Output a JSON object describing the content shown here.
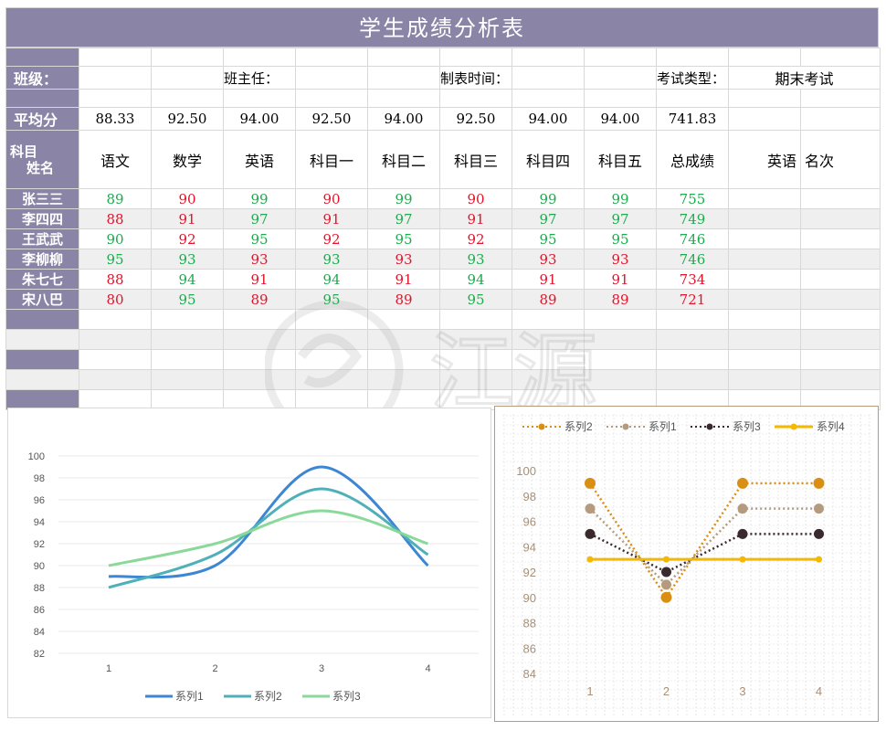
{
  "title": "学生成绩分析表",
  "info": {
    "class_label": "班级：",
    "teacher_label": "班主任：",
    "date_label": "制表时间：",
    "exam_type_label": "考试类型：",
    "exam_type_value": "期末考试"
  },
  "averages": {
    "label": "平均分",
    "values": [
      "88.33",
      "92.50",
      "94.00",
      "92.50",
      "94.00",
      "92.50",
      "94.00",
      "94.00",
      "741.83"
    ]
  },
  "subjects": {
    "corner_top": "科目",
    "corner_bottom": "姓名",
    "names": [
      "语文",
      "数学",
      "英语",
      "科目一",
      "科目二",
      "科目三",
      "科目四",
      "科目五",
      "总成绩"
    ],
    "rank_subject": "英语",
    "rank_label": "名次"
  },
  "students": [
    {
      "name": "张三三",
      "scores": [
        "89",
        "90",
        "99",
        "90",
        "99",
        "90",
        "99",
        "99",
        "755"
      ],
      "colors": [
        "g",
        "r",
        "g",
        "r",
        "g",
        "r",
        "g",
        "g",
        "g"
      ]
    },
    {
      "name": "李四四",
      "scores": [
        "88",
        "91",
        "97",
        "91",
        "97",
        "91",
        "97",
        "97",
        "749"
      ],
      "colors": [
        "r",
        "r",
        "g",
        "r",
        "g",
        "r",
        "g",
        "g",
        "g"
      ]
    },
    {
      "name": "王武武",
      "scores": [
        "90",
        "92",
        "95",
        "92",
        "95",
        "92",
        "95",
        "95",
        "746"
      ],
      "colors": [
        "g",
        "r",
        "g",
        "r",
        "g",
        "r",
        "g",
        "g",
        "g"
      ]
    },
    {
      "name": "李柳柳",
      "scores": [
        "95",
        "93",
        "93",
        "93",
        "93",
        "93",
        "93",
        "93",
        "746"
      ],
      "colors": [
        "g",
        "g",
        "r",
        "g",
        "r",
        "g",
        "r",
        "r",
        "g"
      ]
    },
    {
      "name": "朱七七",
      "scores": [
        "88",
        "94",
        "91",
        "94",
        "91",
        "94",
        "91",
        "91",
        "734"
      ],
      "colors": [
        "r",
        "g",
        "r",
        "g",
        "r",
        "g",
        "r",
        "r",
        "r"
      ]
    },
    {
      "name": "宋八巴",
      "scores": [
        "80",
        "95",
        "89",
        "95",
        "89",
        "95",
        "89",
        "89",
        "721"
      ],
      "colors": [
        "r",
        "g",
        "r",
        "g",
        "r",
        "g",
        "r",
        "r",
        "r"
      ]
    }
  ],
  "watermark_text": "江源",
  "chart_data": [
    {
      "type": "line",
      "smooth": true,
      "x": [
        1,
        2,
        3,
        4
      ],
      "ylim": [
        82,
        100
      ],
      "yticks": [
        82,
        84,
        86,
        88,
        90,
        92,
        94,
        96,
        98,
        100
      ],
      "series": [
        {
          "name": "系列1",
          "values": [
            89,
            90,
            99,
            90
          ],
          "color": "#3d86d4"
        },
        {
          "name": "系列2",
          "values": [
            88,
            91,
            97,
            91
          ],
          "color": "#4fb0b8"
        },
        {
          "name": "系列3",
          "values": [
            90,
            92,
            95,
            92
          ],
          "color": "#8ad99a"
        }
      ],
      "legend": "bottom",
      "grid": true
    },
    {
      "type": "line",
      "x": [
        1,
        2,
        3,
        4
      ],
      "ylim": [
        84,
        100
      ],
      "yticks": [
        84,
        86,
        88,
        90,
        92,
        94,
        96,
        98,
        100
      ],
      "series": [
        {
          "name": "系列2",
          "values": [
            99,
            90,
            99,
            99
          ],
          "color": "#d88f14",
          "dash": true
        },
        {
          "name": "系列1",
          "values": [
            97,
            91,
            97,
            97
          ],
          "color": "#b59a7e",
          "dash": true
        },
        {
          "name": "系列3",
          "values": [
            95,
            92,
            95,
            95
          ],
          "color": "#3a2a2e",
          "dash": true
        },
        {
          "name": "系列4",
          "values": [
            93,
            93,
            93,
            93
          ],
          "color": "#f5b800",
          "dash": false
        }
      ],
      "legend": "top",
      "grid": true
    }
  ]
}
